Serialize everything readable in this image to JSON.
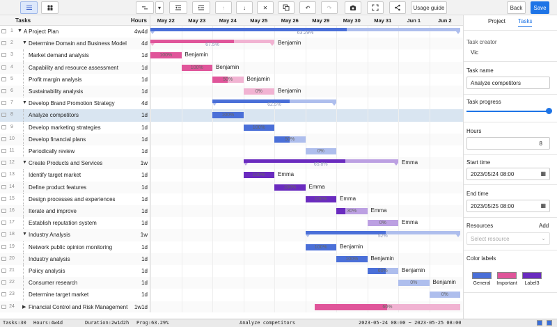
{
  "toolbar": {
    "usage_guide": "Usage guide",
    "back": "Back",
    "save": "Save"
  },
  "grid": {
    "col_tasks": "Tasks",
    "col_hours": "Hours"
  },
  "days": [
    "May 22",
    "May 23",
    "May 24",
    "May 25",
    "May 26",
    "May 29",
    "May 30",
    "May 31",
    "Jun 1",
    "Jun 2"
  ],
  "rows": [
    {
      "n": "1",
      "name": "A Project Plan",
      "hours": "4w4d",
      "level": 0,
      "group": true
    },
    {
      "n": "2",
      "name": "Determine Domain and Business Model",
      "hours": "4d",
      "level": 1,
      "group": true
    },
    {
      "n": "3",
      "name": "Market demand analysis",
      "hours": "1d",
      "level": 2
    },
    {
      "n": "4",
      "name": "Capability and resource assessment",
      "hours": "1d",
      "level": 2
    },
    {
      "n": "5",
      "name": "Profit margin analysis",
      "hours": "1d",
      "level": 2
    },
    {
      "n": "6",
      "name": "Sustainability analysis",
      "hours": "1d",
      "level": 2
    },
    {
      "n": "7",
      "name": "Develop Brand Promotion Strategy",
      "hours": "4d",
      "level": 1,
      "group": true
    },
    {
      "n": "8",
      "name": "Analyze competitors",
      "hours": "1d",
      "level": 2,
      "selected": true
    },
    {
      "n": "9",
      "name": "Develop marketing strategies",
      "hours": "1d",
      "level": 2
    },
    {
      "n": "10",
      "name": "Develop financial plans",
      "hours": "1d",
      "level": 2
    },
    {
      "n": "11",
      "name": "Periodically review",
      "hours": "1d",
      "level": 2
    },
    {
      "n": "12",
      "name": "Create Products and Services",
      "hours": "1w",
      "level": 1,
      "group": true
    },
    {
      "n": "13",
      "name": "Identify target market",
      "hours": "1d",
      "level": 2
    },
    {
      "n": "14",
      "name": "Define product features",
      "hours": "1d",
      "level": 2
    },
    {
      "n": "15",
      "name": "Design processes and experiences",
      "hours": "1d",
      "level": 2
    },
    {
      "n": "16",
      "name": "Iterate and improve",
      "hours": "1d",
      "level": 2
    },
    {
      "n": "17",
      "name": "Establish reputation system",
      "hours": "1d",
      "level": 2
    },
    {
      "n": "18",
      "name": "Industry Analysis",
      "hours": "1w",
      "level": 1,
      "group": true
    },
    {
      "n": "19",
      "name": "Network public opinion monitoring",
      "hours": "1d",
      "level": 2
    },
    {
      "n": "20",
      "name": "Industry analysis",
      "hours": "1d",
      "level": 2
    },
    {
      "n": "21",
      "name": "Policy analysis",
      "hours": "1d",
      "level": 2
    },
    {
      "n": "22",
      "name": "Consumer research",
      "hours": "1d",
      "level": 2
    },
    {
      "n": "23",
      "name": "Determine target market",
      "hours": "1d",
      "level": 2
    },
    {
      "n": "24",
      "name": "Financial Control and Risk Management",
      "hours": "1w1d",
      "level": 1,
      "group": true,
      "collapsed": true
    }
  ],
  "bars": [
    {
      "row": 0,
      "kind": "summary",
      "start": 0,
      "dur": 10,
      "progress": 0.6329,
      "label": "63.29%",
      "color": "#4a6fd8"
    },
    {
      "row": 1,
      "kind": "summary",
      "start": 0,
      "dur": 4,
      "progress": 0.675,
      "label": "67.5%",
      "color": "#e0559a",
      "resource": "Benjamin"
    },
    {
      "row": 2,
      "kind": "task",
      "start": 0,
      "dur": 1,
      "progress": 1.0,
      "label": "100%",
      "color": "#e0559a",
      "resource": "Benjamin"
    },
    {
      "row": 3,
      "kind": "task",
      "start": 1,
      "dur": 1,
      "progress": 1.0,
      "label": "100%",
      "color": "#e0559a",
      "resource": "Benjamin"
    },
    {
      "row": 4,
      "kind": "task",
      "start": 2,
      "dur": 1,
      "progress": 0.5,
      "label": "50%",
      "color": "#e0559a",
      "resource": "Benjamin"
    },
    {
      "row": 5,
      "kind": "task",
      "start": 3,
      "dur": 1,
      "progress": 0,
      "label": "0%",
      "color": "#e0559a",
      "resource": "Benjamin"
    },
    {
      "row": 6,
      "kind": "summary",
      "start": 2,
      "dur": 4,
      "progress": 0.625,
      "label": "62.5%",
      "color": "#4a6fd8"
    },
    {
      "row": 7,
      "kind": "task",
      "start": 2,
      "dur": 1,
      "progress": 1.0,
      "label": "100%",
      "color": "#4a6fd8"
    },
    {
      "row": 8,
      "kind": "task",
      "start": 3,
      "dur": 1,
      "progress": 1.0,
      "label": "100%",
      "color": "#4a6fd8"
    },
    {
      "row": 9,
      "kind": "task",
      "start": 4,
      "dur": 1,
      "progress": 0.5,
      "label": "50%",
      "color": "#4a6fd8"
    },
    {
      "row": 10,
      "kind": "task",
      "start": 5,
      "dur": 1,
      "progress": 0,
      "label": "0%",
      "color": "#4a6fd8"
    },
    {
      "row": 11,
      "kind": "summary",
      "start": 3,
      "dur": 5,
      "progress": 0.658,
      "label": "65.8%",
      "color": "#6a2bbf",
      "resource": "Emma"
    },
    {
      "row": 12,
      "kind": "task",
      "start": 3,
      "dur": 1,
      "progress": 1.0,
      "label": "100%",
      "color": "#6a2bbf",
      "resource": "Emma"
    },
    {
      "row": 13,
      "kind": "task",
      "start": 4,
      "dur": 1,
      "progress": 1.0,
      "label": "100%",
      "color": "#6a2bbf",
      "resource": "Emma"
    },
    {
      "row": 14,
      "kind": "task",
      "start": 5,
      "dur": 1,
      "progress": 1.0,
      "label": "100%",
      "color": "#6a2bbf",
      "resource": "Emma"
    },
    {
      "row": 15,
      "kind": "task",
      "start": 6,
      "dur": 1,
      "progress": 0.3,
      "label": "30%",
      "color": "#6a2bbf",
      "resource": "Emma"
    },
    {
      "row": 16,
      "kind": "task",
      "start": 7,
      "dur": 1,
      "progress": 0,
      "label": "0%",
      "color": "#6a2bbf",
      "resource": "Emma"
    },
    {
      "row": 17,
      "kind": "summary",
      "start": 5,
      "dur": 5,
      "progress": 0.52,
      "label": "52%",
      "color": "#4a6fd8"
    },
    {
      "row": 18,
      "kind": "task",
      "start": 5,
      "dur": 1,
      "progress": 1.0,
      "label": "100%",
      "color": "#4a6fd8",
      "resource": "Benjamin"
    },
    {
      "row": 19,
      "kind": "task",
      "start": 6,
      "dur": 1,
      "progress": 1.0,
      "label": "100%",
      "color": "#4a6fd8",
      "resource": "Benjamin"
    },
    {
      "row": 20,
      "kind": "task",
      "start": 7,
      "dur": 1,
      "progress": 0.6,
      "label": "60%",
      "color": "#4a6fd8",
      "resource": "Benjamin"
    },
    {
      "row": 21,
      "kind": "task",
      "start": 8,
      "dur": 1,
      "progress": 0,
      "label": "0%",
      "color": "#4a6fd8",
      "resource": "Benjamin"
    },
    {
      "row": 22,
      "kind": "task",
      "start": 9,
      "dur": 1,
      "progress": 0,
      "label": "0%",
      "color": "#4a6fd8",
      "resource": "Benjamin"
    },
    {
      "row": 23,
      "kind": "task",
      "start": 5.3,
      "dur": 4.7,
      "progress": 0.5,
      "label": "60%",
      "color": "#e0559a"
    }
  ],
  "status": {
    "tasks": "Tasks:30",
    "hours": "Hours:4w4d",
    "duration": "Duration:2w1d2h",
    "prog": "Prog:63.29%",
    "selected": "Analyze competitors",
    "range": "2023-05-24 08:00 ~ 2023-05-25 08:00"
  },
  "panel": {
    "tab_project": "Project",
    "tab_tasks": "Tasks",
    "creator_label": "Task creator",
    "creator_value": "Vic",
    "name_label": "Task name",
    "name_value": "Analyze competitors",
    "progress_label": "Task progress",
    "progress_value": 1.0,
    "hours_label": "Hours",
    "hours_value": "8",
    "start_label": "Start time",
    "start_value": "2023/05/24 08:00",
    "end_label": "End time",
    "end_value": "2023/05/25 08:00",
    "resources_label": "Resources",
    "resources_add": "Add",
    "resource_placeholder": "Select resource",
    "color_labels_title": "Color labels",
    "colors": [
      {
        "name": "General",
        "hex": "#4a6fd8"
      },
      {
        "name": "Important",
        "hex": "#e0559a"
      },
      {
        "name": "Label3",
        "hex": "#6a2bbf"
      }
    ]
  }
}
